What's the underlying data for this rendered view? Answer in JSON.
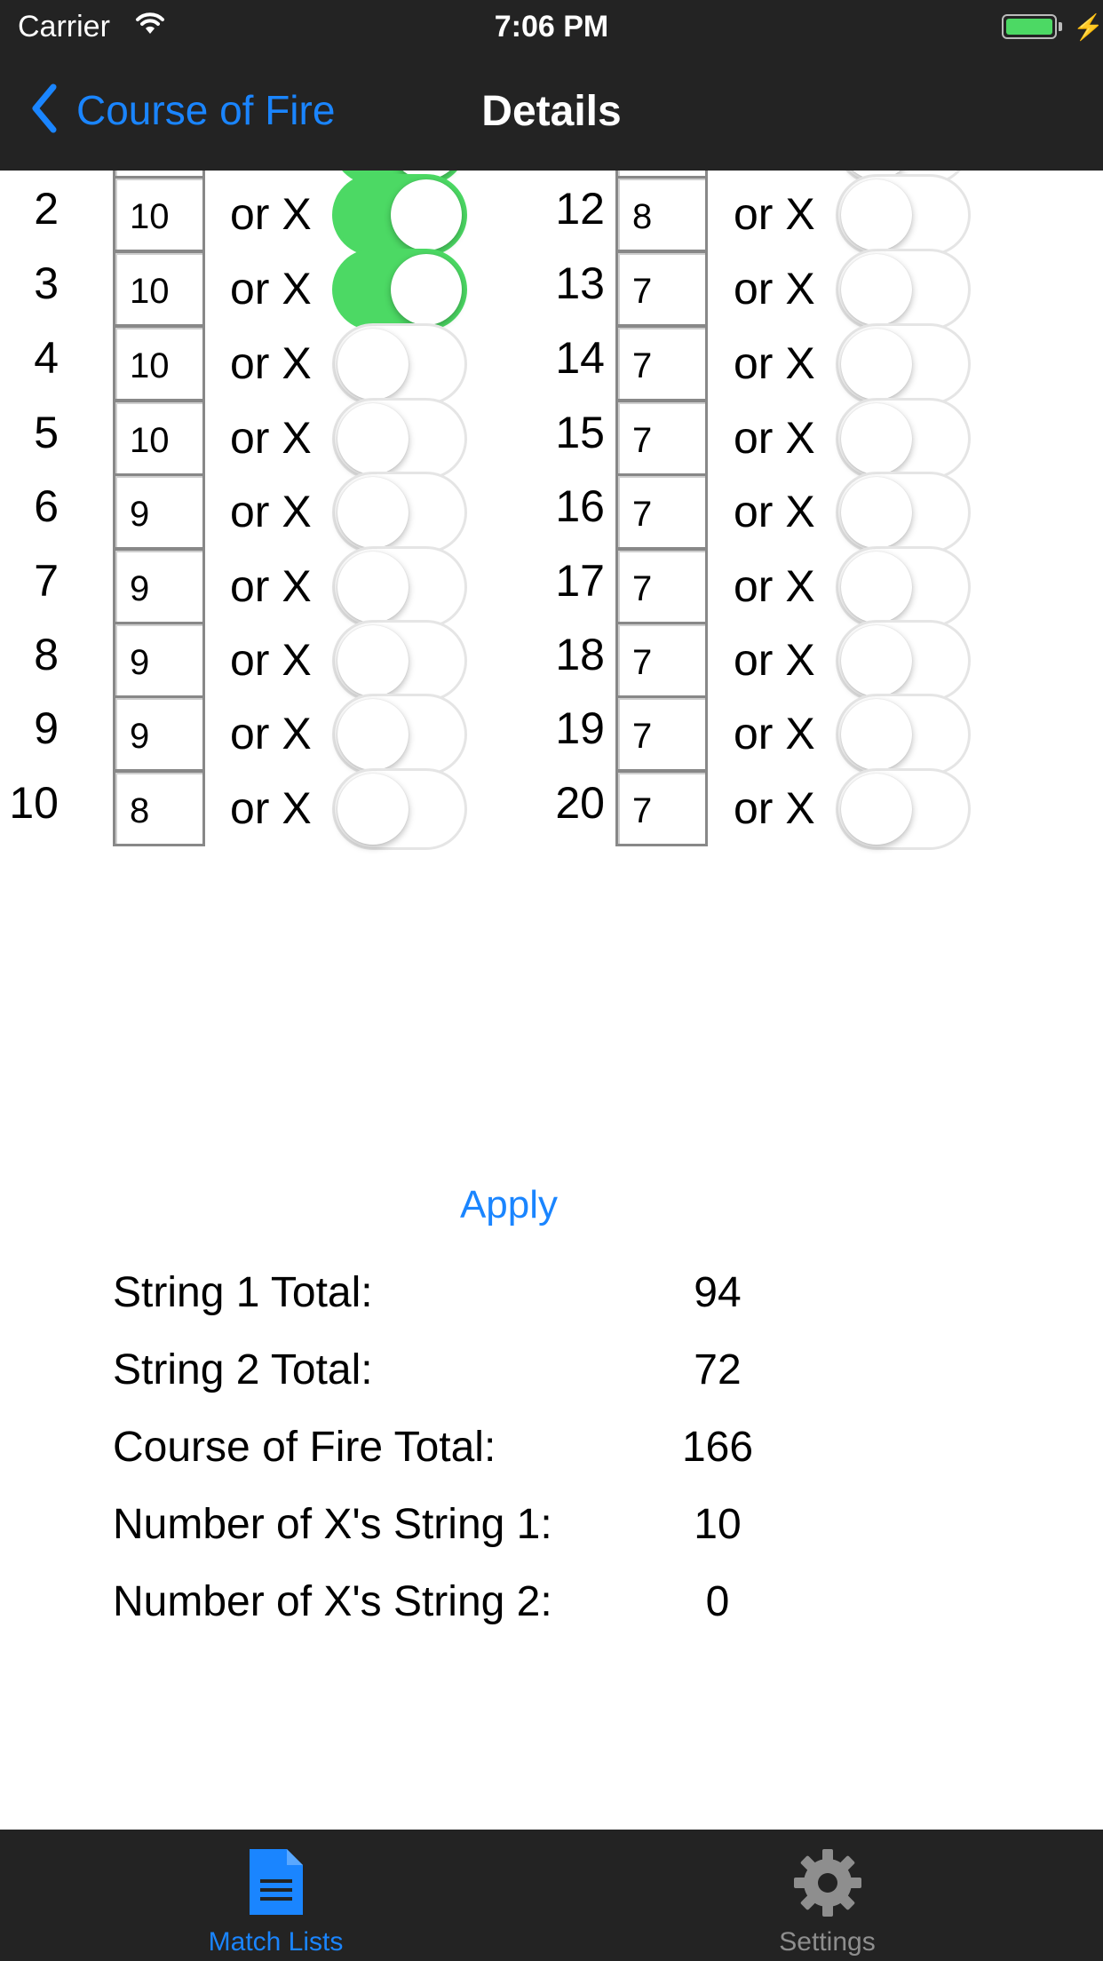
{
  "status_bar": {
    "carrier": "Carrier",
    "time": "7:06 PM"
  },
  "nav": {
    "back_label": "Course of Fire",
    "title": "Details"
  },
  "string1": [
    {
      "num": "",
      "score": "",
      "x_on": true
    },
    {
      "num": "2",
      "score": "10",
      "x_on": true
    },
    {
      "num": "3",
      "score": "10",
      "x_on": true
    },
    {
      "num": "4",
      "score": "10",
      "x_on": false
    },
    {
      "num": "5",
      "score": "10",
      "x_on": false
    },
    {
      "num": "6",
      "score": "9",
      "x_on": false
    },
    {
      "num": "7",
      "score": "9",
      "x_on": false
    },
    {
      "num": "8",
      "score": "9",
      "x_on": false
    },
    {
      "num": "9",
      "score": "9",
      "x_on": false
    },
    {
      "num": "10",
      "score": "8",
      "x_on": false
    }
  ],
  "string2": [
    {
      "num": "",
      "score": "",
      "x_on": false
    },
    {
      "num": "12",
      "score": "8",
      "x_on": false
    },
    {
      "num": "13",
      "score": "7",
      "x_on": false
    },
    {
      "num": "14",
      "score": "7",
      "x_on": false
    },
    {
      "num": "15",
      "score": "7",
      "x_on": false
    },
    {
      "num": "16",
      "score": "7",
      "x_on": false
    },
    {
      "num": "17",
      "score": "7",
      "x_on": false
    },
    {
      "num": "18",
      "score": "7",
      "x_on": false
    },
    {
      "num": "19",
      "score": "7",
      "x_on": false
    },
    {
      "num": "20",
      "score": "7",
      "x_on": false
    }
  ],
  "or_x_label": "or X",
  "apply_label": "Apply",
  "totals": [
    {
      "label": "String 1 Total:",
      "value": "94"
    },
    {
      "label": "String 2 Total:",
      "value": "72"
    },
    {
      "label": "Course of Fire Total:",
      "value": "166"
    },
    {
      "label": "Number of X's String 1:",
      "value": "10"
    },
    {
      "label": "Number of X's String 2:",
      "value": "0"
    }
  ],
  "tabs": [
    {
      "label": "Match Lists",
      "icon": "document-icon",
      "selected": true
    },
    {
      "label": "Settings",
      "icon": "gear-icon",
      "selected": false
    }
  ],
  "colors": {
    "accent": "#1a85ff",
    "toggle_on": "#4cd964",
    "bar_bg": "#232323",
    "tab_inactive": "#8e8e8e"
  }
}
